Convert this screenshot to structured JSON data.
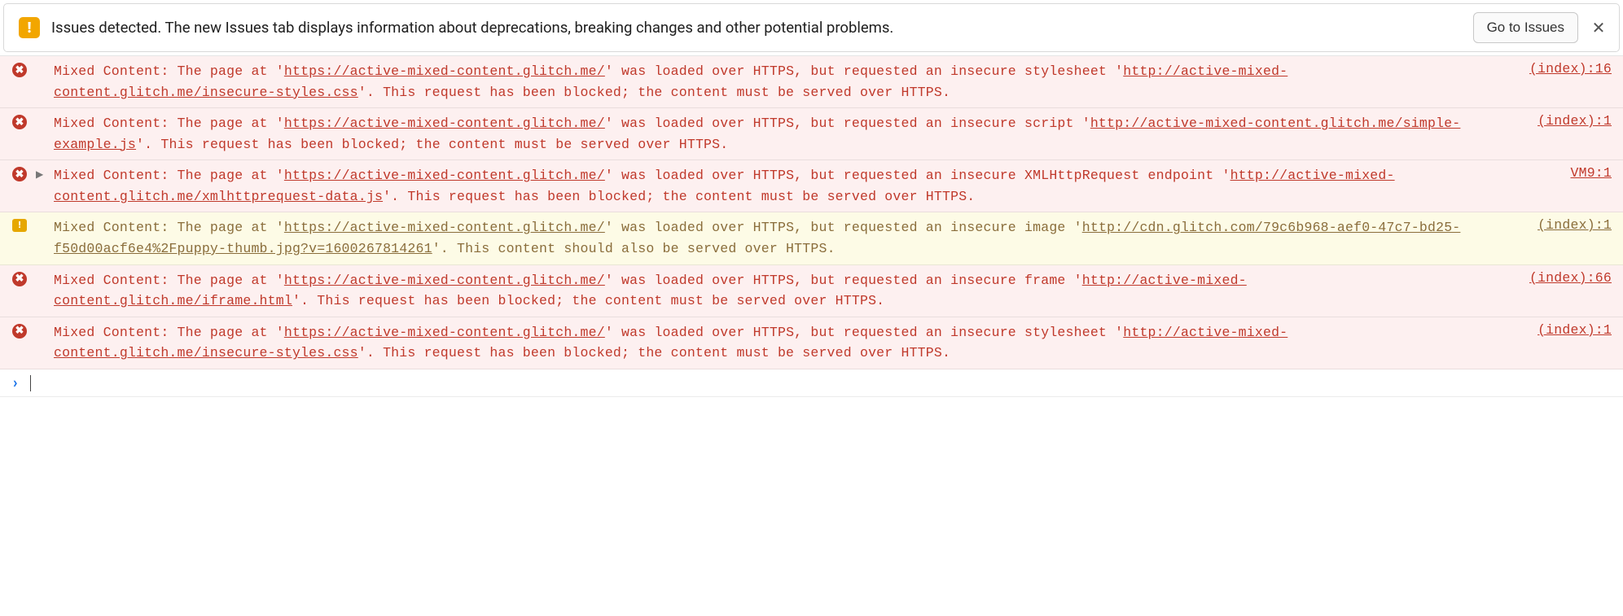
{
  "issues_bar": {
    "badge_glyph": "!",
    "text": "Issues detected. The new Issues tab displays information about deprecations, breaking changes and other potential problems.",
    "button_label": "Go to Issues",
    "close_glyph": "✕"
  },
  "entries": [
    {
      "level": "error",
      "expandable": false,
      "source": "(index):16",
      "segments": [
        {
          "t": "Mixed Content: The page at '"
        },
        {
          "t": "https://active-mixed-content.glitch.me/",
          "ul": true
        },
        {
          "t": "' was loaded over HTTPS, but requested an insecure stylesheet '"
        },
        {
          "t": "http://active-mixed-content.glitch.me/insecure-styles.css",
          "ul": true
        },
        {
          "t": "'. This request has been blocked; the content must be served over HTTPS."
        }
      ]
    },
    {
      "level": "error",
      "expandable": false,
      "source": "(index):1",
      "segments": [
        {
          "t": "Mixed Content: The page at '"
        },
        {
          "t": "https://active-mixed-content.glitch.me/",
          "ul": true
        },
        {
          "t": "' was loaded over HTTPS, but requested an insecure script '"
        },
        {
          "t": "http://active-mixed-content.glitch.me/simple-example.js",
          "ul": true
        },
        {
          "t": "'. This request has been blocked; the content must be served over HTTPS."
        }
      ]
    },
    {
      "level": "error",
      "expandable": true,
      "source": "VM9:1",
      "segments": [
        {
          "t": "Mixed Content: The page at '"
        },
        {
          "t": "https://active-mixed-content.glitch.me/",
          "ul": true
        },
        {
          "t": "' was loaded over HTTPS, but requested an insecure XMLHttpRequest endpoint '"
        },
        {
          "t": "http://active-mixed-content.glitch.me/xmlhttprequest-data.js",
          "ul": true
        },
        {
          "t": "'. This request has been blocked; the content must be served over HTTPS."
        }
      ]
    },
    {
      "level": "warning",
      "expandable": false,
      "source": "(index):1",
      "segments": [
        {
          "t": "Mixed Content: The page at '"
        },
        {
          "t": "https://active-mixed-content.glitch.me/",
          "ul": true
        },
        {
          "t": "' was loaded over HTTPS, but requested an insecure image '"
        },
        {
          "t": "http://cdn.glitch.com/79c6b968-aef0-47c7-bd25-f50d00acf6e4%2Fpuppy-thumb.jpg?v=1600267814261",
          "ul": true
        },
        {
          "t": "'. This content should also be served over HTTPS."
        }
      ]
    },
    {
      "level": "error",
      "expandable": false,
      "source": "(index):66",
      "segments": [
        {
          "t": "Mixed Content: The page at '"
        },
        {
          "t": "https://active-mixed-content.glitch.me/",
          "ul": true
        },
        {
          "t": "' was loaded over HTTPS, but requested an insecure frame '"
        },
        {
          "t": "http://active-mixed-content.glitch.me/iframe.html",
          "ul": true
        },
        {
          "t": "'. This request has been blocked; the content must be served over HTTPS."
        }
      ]
    },
    {
      "level": "error",
      "expandable": false,
      "source": "(index):1",
      "segments": [
        {
          "t": "Mixed Content: The page at '"
        },
        {
          "t": "https://active-mixed-content.glitch.me/",
          "ul": true
        },
        {
          "t": "' was loaded over HTTPS, but requested an insecure stylesheet '"
        },
        {
          "t": "http://active-mixed-content.glitch.me/insecure-styles.css",
          "ul": true
        },
        {
          "t": "'. This request has been blocked; the content must be served over HTTPS."
        }
      ]
    }
  ],
  "prompt_glyph": "›"
}
